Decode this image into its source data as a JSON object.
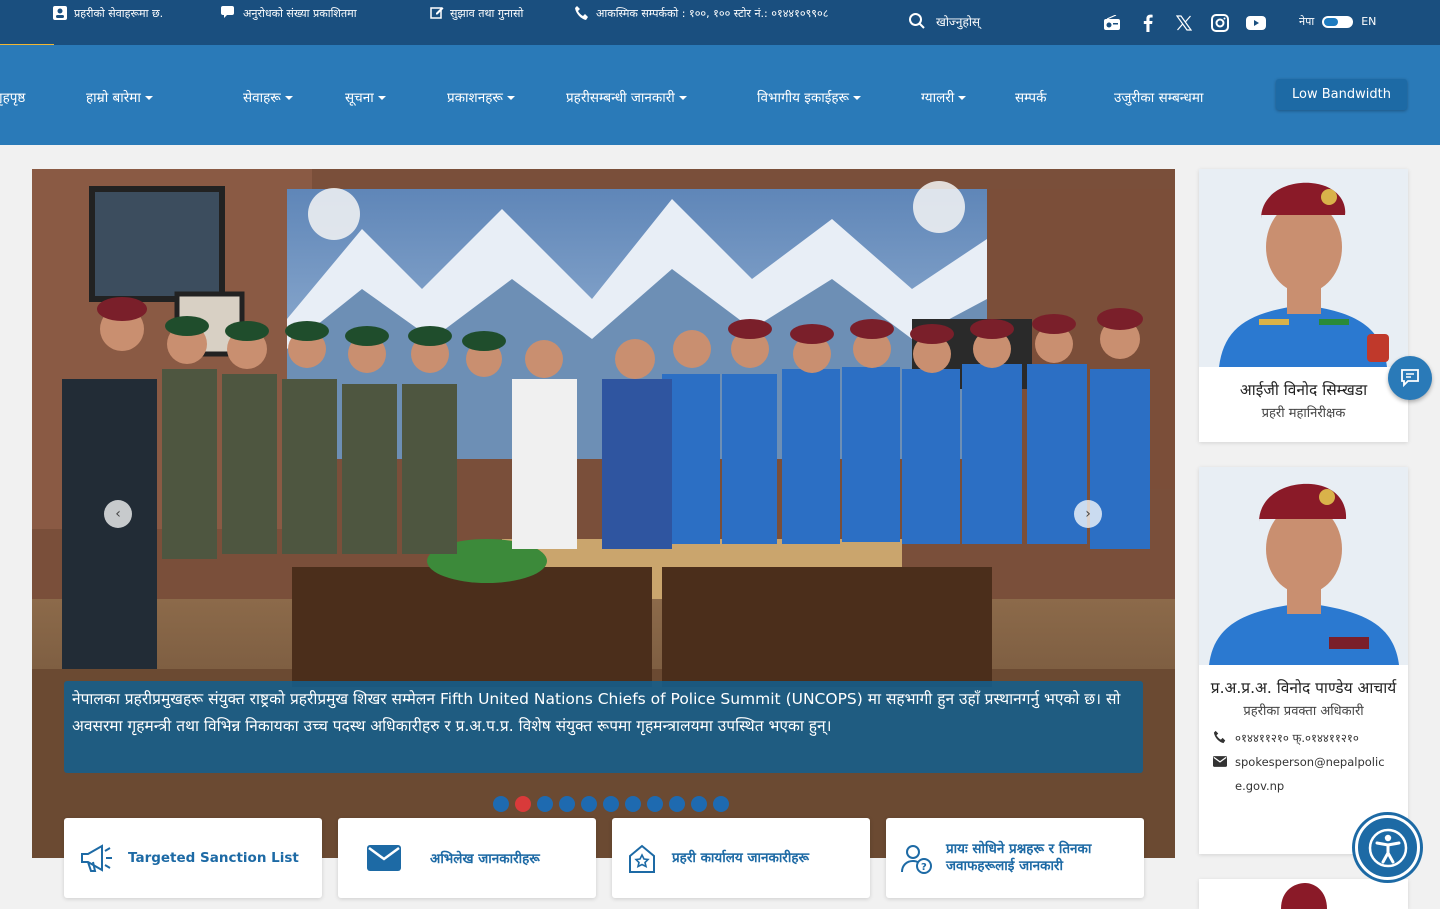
{
  "topbar": {
    "items": [
      "प्रहरीको सेवाहरूमा छ.",
      "अनुरोधको संख्या प्रकाशितमा",
      "सुझाव तथा गुनासो",
      "आकस्मिक सम्पर्कको : १००, १०० स्टोर नं.: ०१४४१०९९०८"
    ],
    "search_label": "खोज्नुहोस्",
    "lang_left": "नेपा",
    "lang_right": "EN"
  },
  "nav": {
    "items": [
      "गृहपृष्ठ",
      "हाम्रो बारेमा",
      "सेवाहरू",
      "सूचना",
      "प्रकाशनहरू",
      "प्रहरीसम्बन्धी जानकारी",
      "विभागीय इकाईहरू",
      "ग्यालरी",
      "सम्पर्क",
      "उजुरीका सम्बन्धमा"
    ],
    "low_bandwidth": "Low Bandwidth"
  },
  "hero": {
    "caption": "नेपालका प्रहरीप्रमुखहरू संयुक्त राष्ट्रको प्रहरीप्रमुख शिखर सम्मेलन Fifth United Nations Chiefs of Police Summit (UNCOPS) मा सहभागी हुन उहाँ प्रस्थानगर्नु भएको छ। सो अवसरमा गृहमन्त्री तथा विभिन्न निकायका उच्च पदस्थ अधिकारीहरु र प्र.अ.प.प्र. विशेष संयुक्त रूपमा गृहमन्त्रालयमा उपस्थित भएका हुन्।",
    "prev": "‹",
    "next": "›",
    "slide_count": 11,
    "active_slide": 1
  },
  "quick_links": [
    {
      "label": "Targeted Sanction List",
      "icon": "megaphone-icon"
    },
    {
      "label": "अभिलेख जानकारीहरू",
      "icon": "envelope-icon"
    },
    {
      "label": "प्रहरी कार्यालय जानकारीहरू",
      "icon": "police-station-icon"
    },
    {
      "label": "प्रायः सोधिने प्रश्नहरू र तिनका जवाफहरूलाई जानकारी",
      "icon": "user-question-icon"
    }
  ],
  "profiles": [
    {
      "name": "आईजी विनोद सिम्खडा",
      "role": "प्रहरी महानिरीक्षक"
    },
    {
      "name": "प्र.अ.प्र.अ. विनोद पाण्डेय आचार्य",
      "role": "प्रहरीका प्रवक्ता अधिकारी",
      "phone": "०१४४११२१० फ्.०१४४११२१०",
      "email": "spokesperson@nepalpolice.gov.np"
    }
  ],
  "colors": {
    "topbar": "#1a4f7f",
    "nav": "#2a7ab8",
    "accent": "#f2b632",
    "active_dot": "#d93a3a"
  }
}
